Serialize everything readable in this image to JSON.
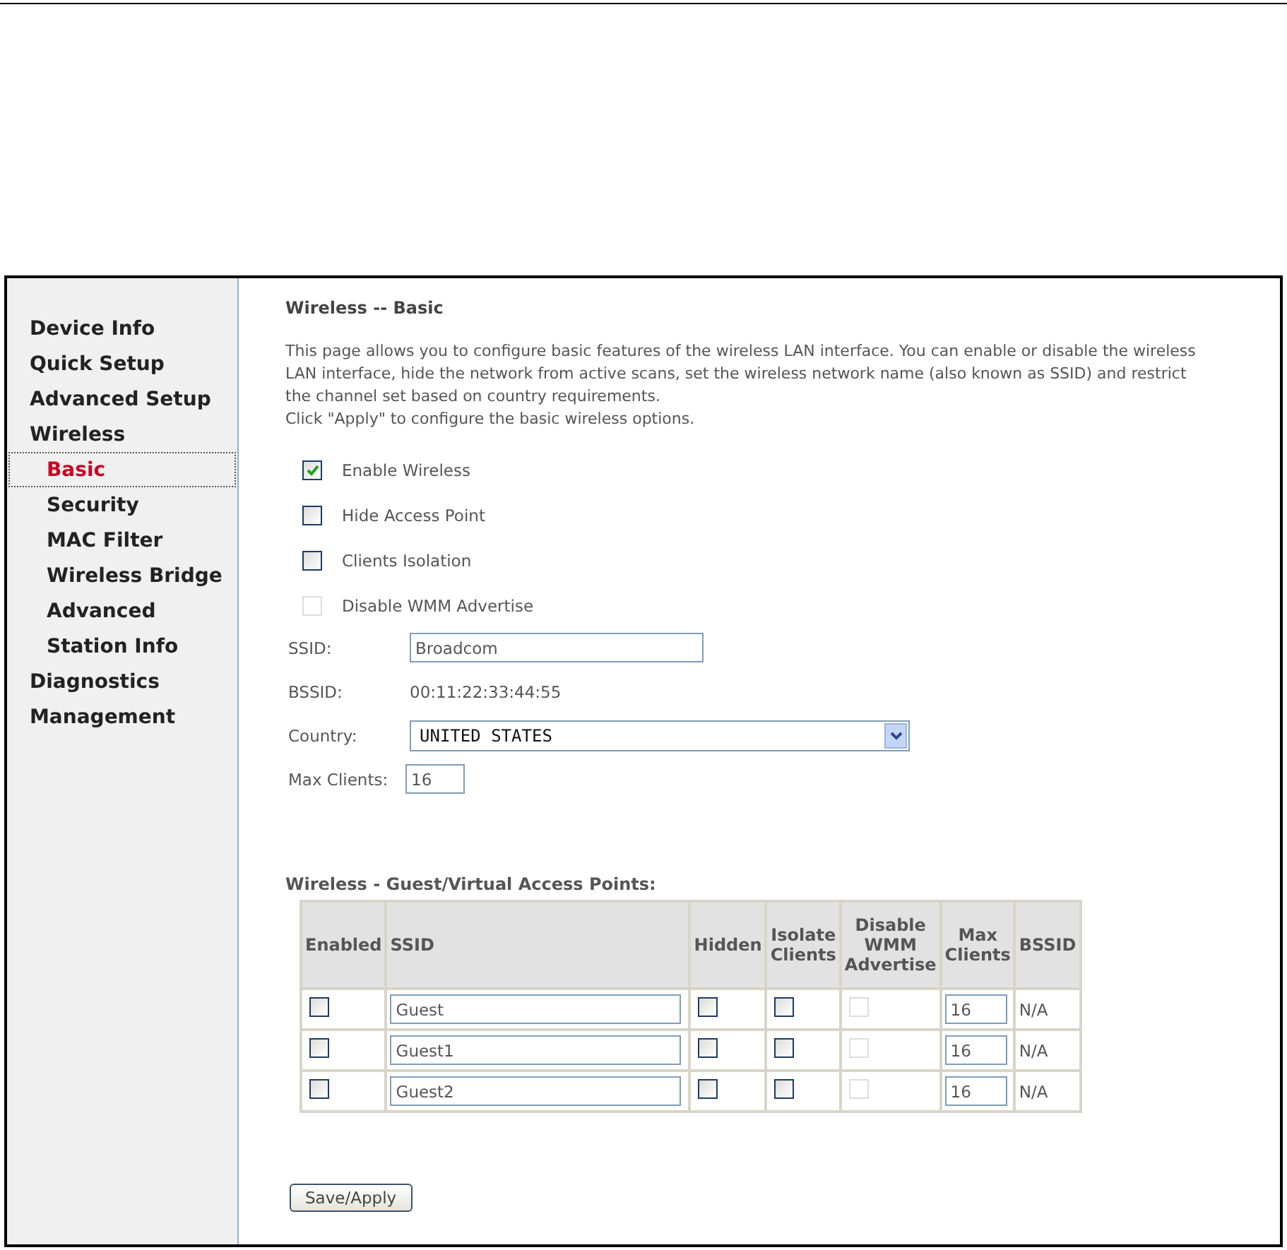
{
  "sidebar": {
    "items": [
      {
        "label": "Device Info",
        "selected": false
      },
      {
        "label": "Quick Setup",
        "selected": false
      },
      {
        "label": "Advanced Setup",
        "selected": false
      },
      {
        "label": "Wireless",
        "selected": false,
        "children": [
          {
            "label": "Basic",
            "selected": true
          },
          {
            "label": "Security",
            "selected": false
          },
          {
            "label": "MAC Filter",
            "selected": false
          },
          {
            "label": "Wireless Bridge",
            "selected": false
          },
          {
            "label": "Advanced",
            "selected": false
          },
          {
            "label": "Station Info",
            "selected": false
          }
        ]
      },
      {
        "label": "Diagnostics",
        "selected": false
      },
      {
        "label": "Management",
        "selected": false
      }
    ]
  },
  "page": {
    "title": "Wireless -- Basic",
    "description": [
      "This page allows you to configure basic features of the wireless LAN interface. You can enable or disable the wireless LAN interface, hide the network from active scans, set the wireless network name (also known as SSID) and restrict the channel set based on country requirements.",
      "Click \"Apply\" to configure the basic wireless options."
    ],
    "options": [
      {
        "label": "Enable Wireless",
        "checked": true,
        "disabled": false
      },
      {
        "label": "Hide Access Point",
        "checked": false,
        "disabled": false
      },
      {
        "label": "Clients Isolation",
        "checked": false,
        "disabled": false
      },
      {
        "label": "Disable WMM Advertise",
        "checked": false,
        "disabled": true
      }
    ],
    "fields": [
      {
        "kind": "input",
        "label": "SSID:",
        "value": "Broadcom"
      },
      {
        "kind": "text",
        "label": "BSSID:",
        "value": "00:11:22:33:44:55"
      },
      {
        "kind": "select",
        "label": "Country:",
        "value": "UNITED STATES"
      },
      {
        "kind": "small-input",
        "label": "Max Clients:",
        "value": "16"
      }
    ]
  },
  "guest_table": {
    "title": "Wireless - Guest/Virtual Access Points:",
    "columns": [
      "Enabled",
      "SSID",
      "Hidden",
      "Isolate Clients",
      "Disable WMM Advertise",
      "Max Clients",
      "BSSID"
    ],
    "rows": [
      {
        "enabled": false,
        "ssid": "Guest",
        "hidden": false,
        "isolate": false,
        "wmm": {
          "checked": false,
          "disabled": true
        },
        "max_clients": "16",
        "bssid": "N/A"
      },
      {
        "enabled": false,
        "ssid": "Guest1",
        "hidden": false,
        "isolate": false,
        "wmm": {
          "checked": false,
          "disabled": true
        },
        "max_clients": "16",
        "bssid": "N/A"
      },
      {
        "enabled": false,
        "ssid": "Guest2",
        "hidden": false,
        "isolate": false,
        "wmm": {
          "checked": false,
          "disabled": true
        },
        "max_clients": "16",
        "bssid": "N/A"
      }
    ]
  },
  "buttons": [
    "Save/Apply"
  ]
}
